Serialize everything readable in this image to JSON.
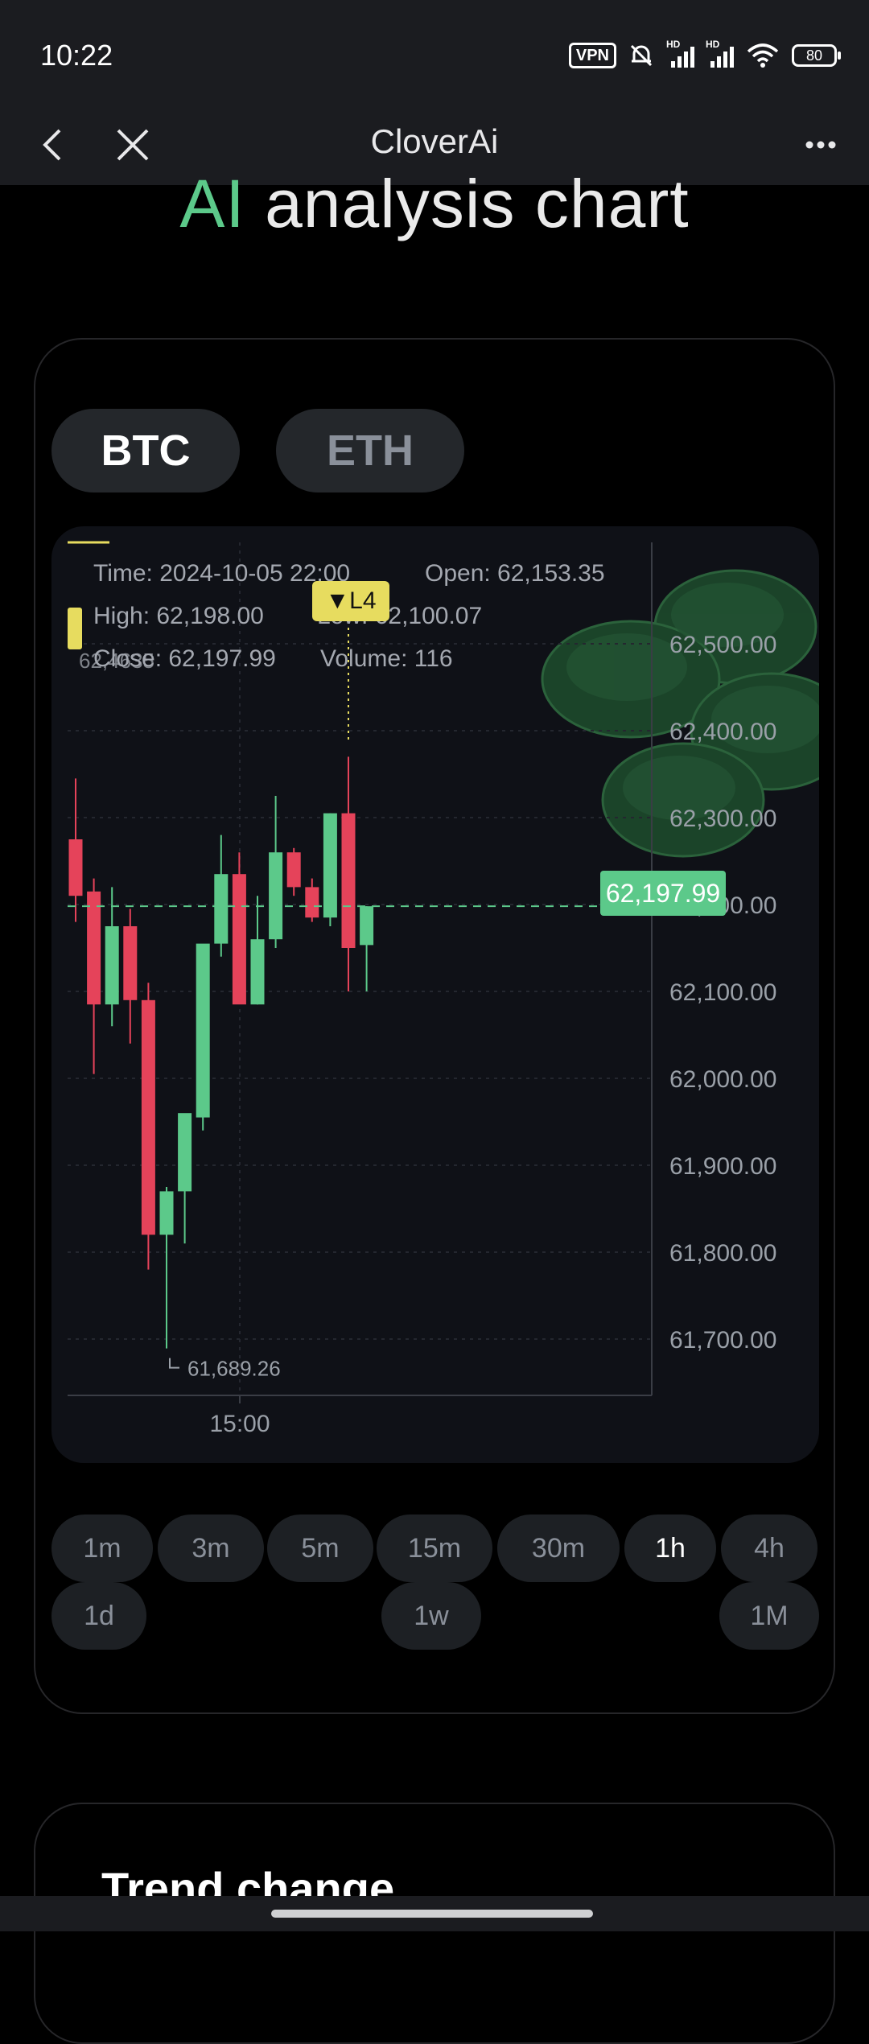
{
  "status_bar": {
    "time": "10:22",
    "vpn_label": "VPN",
    "hd_label": "HD",
    "battery_level": "80"
  },
  "nav": {
    "title": "CloverAi",
    "back_icon": "chevron-left-icon",
    "close_icon": "close-icon",
    "more_icon": "more-horizontal-icon"
  },
  "headline": {
    "ai": "AI",
    "rest": " analysis chart"
  },
  "coins": {
    "active": "BTC",
    "inactive": "ETH"
  },
  "chart_info": {
    "time": "Time: 2024-10-05 22:00",
    "open": "Open: 62,153.35",
    "high": "High: 62,198.00",
    "low": "Low: 62,100.07",
    "close": "Close: 62,197.99",
    "volume": "Volume: 116",
    "overlap_value": "62,4635",
    "marker_label": "▼L4"
  },
  "chart_data": {
    "type": "candlestick",
    "symbol": "BTC",
    "interval": "1h",
    "ylim": [
      61640,
      62560
    ],
    "y_ticks": [
      "62,500.00",
      "62,400.00",
      "62,300.00",
      "62,200.00",
      "62,100.00",
      "62,000.00",
      "61,900.00",
      "61,800.00",
      "61,700.00"
    ],
    "x_tick_labels": [
      "15:00"
    ],
    "last_price": "62,197.99",
    "min_label": "61,689.26",
    "colors": {
      "up": "#5cc98a",
      "down": "#e5435a",
      "marker": "#e7dc5f"
    },
    "candles": [
      {
        "o": 62275,
        "h": 62345,
        "l": 62180,
        "c": 62210
      },
      {
        "o": 62215,
        "h": 62230,
        "l": 62005,
        "c": 62085
      },
      {
        "o": 62085,
        "h": 62220,
        "l": 62060,
        "c": 62175
      },
      {
        "o": 62175,
        "h": 62195,
        "l": 62040,
        "c": 62090
      },
      {
        "o": 62090,
        "h": 62110,
        "l": 61780,
        "c": 61820
      },
      {
        "o": 61820,
        "h": 61875,
        "l": 61689.26,
        "c": 61870
      },
      {
        "o": 61870,
        "h": 61910,
        "l": 61810,
        "c": 61960
      },
      {
        "o": 61955,
        "h": 62020,
        "l": 61940,
        "c": 62155
      },
      {
        "o": 62155,
        "h": 62280,
        "l": 62140,
        "c": 62235
      },
      {
        "o": 62235,
        "h": 62260,
        "l": 62100,
        "c": 62085
      },
      {
        "o": 62085,
        "h": 62210,
        "l": 62085,
        "c": 62160
      },
      {
        "o": 62160,
        "h": 62325,
        "l": 62150,
        "c": 62260
      },
      {
        "o": 62260,
        "h": 62265,
        "l": 62210,
        "c": 62220
      },
      {
        "o": 62220,
        "h": 62230,
        "l": 62180,
        "c": 62185
      },
      {
        "o": 62185,
        "h": 62305,
        "l": 62175,
        "c": 62305
      },
      {
        "o": 62305,
        "h": 62370,
        "l": 62100,
        "c": 62150
      },
      {
        "o": 62153.35,
        "h": 62198.0,
        "l": 62100.07,
        "c": 62197.99
      }
    ]
  },
  "timeframes": [
    {
      "label": "1m"
    },
    {
      "label": "3m"
    },
    {
      "label": "5m"
    },
    {
      "label": "15m"
    },
    {
      "label": "30m"
    },
    {
      "label": "1h"
    },
    {
      "label": "4h"
    },
    {
      "label": "1d"
    },
    {
      "label": "1w"
    },
    {
      "label": "1M"
    }
  ],
  "active_timeframe": "1h",
  "trend": {
    "title": "Trend change"
  }
}
